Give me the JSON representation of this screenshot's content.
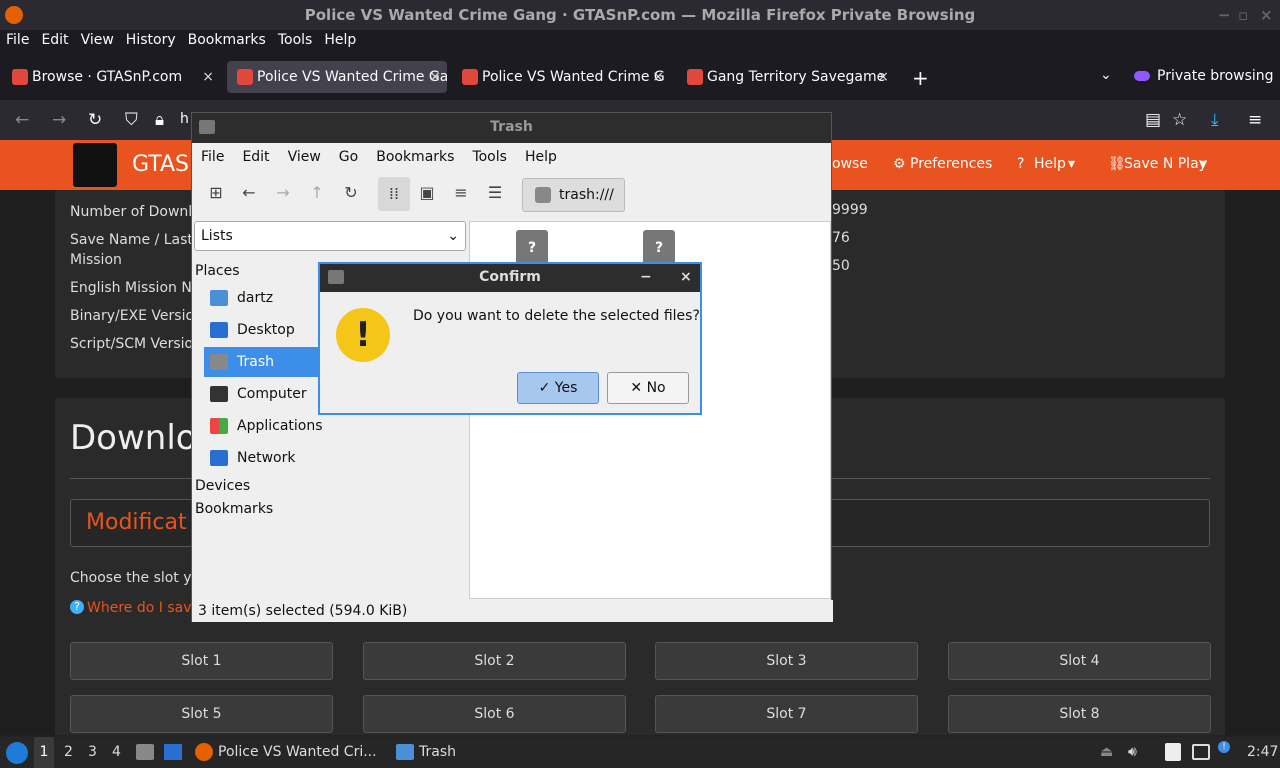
{
  "window": {
    "title": "Police VS Wanted Crime Gang · GTASnP.com — Mozilla Firefox Private Browsing"
  },
  "menubar": [
    "File",
    "Edit",
    "View",
    "History",
    "Bookmarks",
    "Tools",
    "Help"
  ],
  "tabs": [
    {
      "label": "Browse · GTASnP.com"
    },
    {
      "label": "Police VS Wanted Crime Ga"
    },
    {
      "label": "Police VS Wanted Crime G"
    },
    {
      "label": "Gang Territory Savegame"
    }
  ],
  "private_label": "Private browsing",
  "url_partial": "h",
  "site": {
    "logo": "GTASn",
    "nav": {
      "browse": "owse",
      "preferences": "Preferences",
      "help": "Help",
      "save_n_play": "Save N Play"
    },
    "info_rows": [
      {
        "label": "Number of Downlo",
        "value": "9999"
      },
      {
        "label": "Save Name / Last\nMission",
        "value": "76"
      },
      {
        "label": "English Mission Na",
        "value": "50"
      },
      {
        "label": "Binary/EXE Versio",
        "value": ""
      },
      {
        "label": "Script/SCM Versio",
        "value": ""
      }
    ],
    "download_heading": "Downlo",
    "modif_heading": "Modificat",
    "choose_text": "Choose the slot you",
    "where_link": "Where do I save",
    "slots": [
      "Slot 1",
      "Slot 2",
      "Slot 3",
      "Slot 4",
      "Slot 5",
      "Slot 6",
      "Slot 7",
      "Slot 8"
    ]
  },
  "filemanager": {
    "title": "Trash",
    "menu": [
      "File",
      "Edit",
      "View",
      "Go",
      "Bookmarks",
      "Tools",
      "Help"
    ],
    "location": "trash:///",
    "side_dropdown": "Lists",
    "places_header": "Places",
    "places": [
      "dartz",
      "Desktop",
      "Trash",
      "Computer",
      "Applications",
      "Network"
    ],
    "devices_header": "Devices",
    "bookmarks_header": "Bookmarks",
    "status": "3 item(s) selected (594.0 KiB)"
  },
  "dialog": {
    "title": "Confirm",
    "message": "Do you want to delete the selected files?",
    "yes": "Yes",
    "no": "No"
  },
  "taskbar": {
    "workspaces": [
      "1",
      "2",
      "3",
      "4"
    ],
    "firefox_task": "Police VS Wanted Cri...",
    "trash_task": "Trash",
    "clock": "2:47"
  }
}
